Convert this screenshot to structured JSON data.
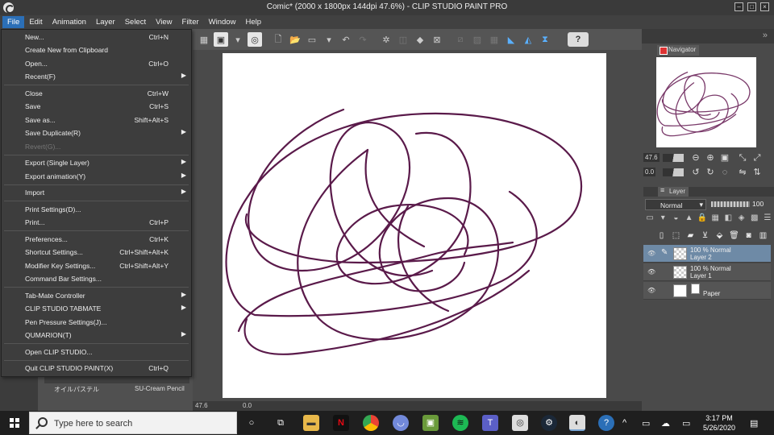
{
  "window": {
    "title": "Comic* (2000 x 1800px 144dpi 47.6%) - CLIP STUDIO PAINT PRO"
  },
  "menubar": [
    "File",
    "Edit",
    "Animation",
    "Layer",
    "Select",
    "View",
    "Filter",
    "Window",
    "Help"
  ],
  "file_menu": {
    "new": {
      "label": "New...",
      "shortcut": "Ctrl+N"
    },
    "new_clipboard": {
      "label": "Create New from Clipboard"
    },
    "open": {
      "label": "Open...",
      "shortcut": "Ctrl+O"
    },
    "recent": {
      "label": "Recent(F)"
    },
    "close": {
      "label": "Close",
      "shortcut": "Ctrl+W"
    },
    "save": {
      "label": "Save",
      "shortcut": "Ctrl+S"
    },
    "save_as": {
      "label": "Save as...",
      "shortcut": "Shift+Alt+S"
    },
    "save_duplicate": {
      "label": "Save Duplicate(R)"
    },
    "revert": {
      "label": "Revert(G)..."
    },
    "export_single": {
      "label": "Export (Single Layer)"
    },
    "export_anim": {
      "label": "Export animation(Y)"
    },
    "import": {
      "label": "Import"
    },
    "print_settings": {
      "label": "Print Settings(D)..."
    },
    "print": {
      "label": "Print...",
      "shortcut": "Ctrl+P"
    },
    "preferences": {
      "label": "Preferences...",
      "shortcut": "Ctrl+K"
    },
    "shortcut_settings": {
      "label": "Shortcut Settings...",
      "shortcut": "Ctrl+Shift+Alt+K"
    },
    "modifier_key": {
      "label": "Modifier Key Settings...",
      "shortcut": "Ctrl+Shift+Alt+Y"
    },
    "command_bar": {
      "label": "Command Bar Settings..."
    },
    "tabmate": {
      "label": "Tab-Mate Controller"
    },
    "tabmate2": {
      "label": "CLIP STUDIO TABMATE"
    },
    "pen_pressure": {
      "label": "Pen Pressure Settings(J)..."
    },
    "qumarion": {
      "label": "QUMARION(T)"
    },
    "open_clip": {
      "label": "Open CLIP STUDIO..."
    },
    "quit": {
      "label": "Quit CLIP STUDIO PAINT(X)",
      "shortcut": "Ctrl+Q"
    }
  },
  "subtool": {
    "brush1": "オイルパステル",
    "brush2": "SU-Cream Pencil"
  },
  "status": {
    "zoom": "47.6",
    "rotate": "0.0"
  },
  "navigator": {
    "tab": "Navigator",
    "zoom": "47.6",
    "rotate": "0.0"
  },
  "layer_panel": {
    "tab": "Layer",
    "blend_mode": "Normal",
    "opacity": "100",
    "layers": [
      {
        "line1": "100 % Normal",
        "line2": "Layer 2",
        "selected": true
      },
      {
        "line1": "100 % Normal",
        "line2": "Layer 1",
        "selected": false
      },
      {
        "line1": "",
        "line2": "Paper",
        "selected": false
      }
    ]
  },
  "taskbar": {
    "search_placeholder": "Type here to search",
    "time": "3:17 PM",
    "date": "5/26/2020"
  },
  "colors": {
    "stroke": "#5a1a4a",
    "accent": "#2b6fb7"
  }
}
